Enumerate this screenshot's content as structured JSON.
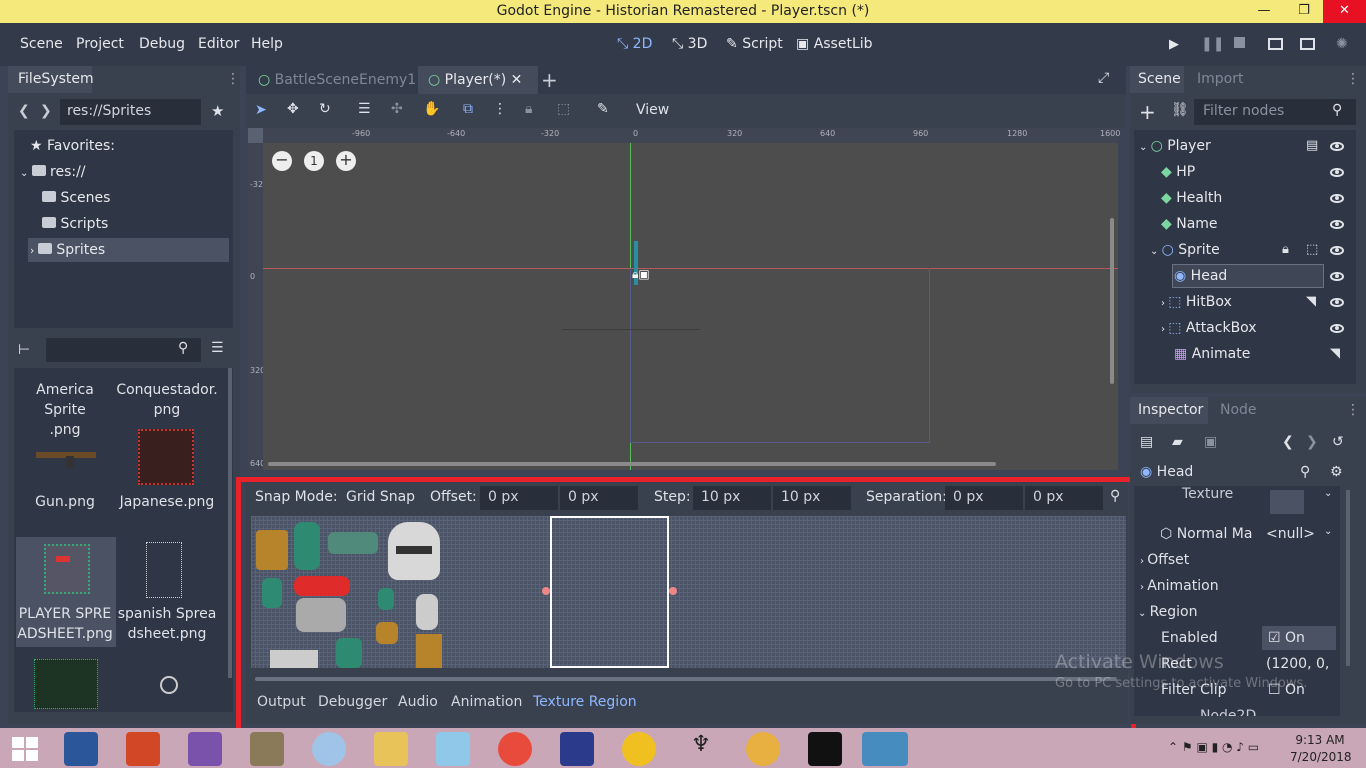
{
  "window": {
    "title": "Godot Engine - Historian Remastered - Player.tscn (*)",
    "min": "—",
    "max": "❐",
    "close": "✕"
  },
  "menu": [
    "Scene",
    "Project",
    "Debug",
    "Editor",
    "Help"
  ],
  "workspaces": [
    "2D",
    "3D",
    "Script",
    "AssetLib"
  ],
  "filesystem": {
    "tab": "FileSystem",
    "path": "res://Sprites",
    "tree": [
      "Favorites:",
      "res://",
      "Scenes",
      "Scripts",
      "Sprites"
    ],
    "files": [
      {
        "name": "America Sprite\n.png"
      },
      {
        "name": "Conquestador.\npng"
      },
      {
        "name": "Gun.png"
      },
      {
        "name": "Japanese.png"
      },
      {
        "name": "PLAYER SPRE\nADSHEET.png"
      },
      {
        "name": "spanish Sprea\ndsheet.png"
      }
    ]
  },
  "scene_tabs": [
    "BattleSceneEnemy1",
    "Player(*)"
  ],
  "toolbar": {
    "view": "View"
  },
  "ruler_x": [
    "-960",
    "-640",
    "-320",
    "0",
    "320",
    "640",
    "960",
    "1280",
    "1600"
  ],
  "ruler_y": [
    "-320",
    "0",
    "320",
    "640"
  ],
  "zoom": {
    "reset": "1"
  },
  "texture_region": {
    "snap_mode_label": "Snap Mode:",
    "snap_mode": "Grid Snap",
    "offset_label": "Offset:",
    "offset_x": "0 px",
    "offset_y": "0 px",
    "step_label": "Step:",
    "step_x": "10 px",
    "step_y": "10 px",
    "separation_label": "Separation:",
    "sep_x": "0 px",
    "sep_y": "0 px"
  },
  "bottom_tabs": [
    "Output",
    "Debugger",
    "Audio",
    "Animation",
    "Texture Region"
  ],
  "scene_dock": {
    "tabs": [
      "Scene",
      "Import"
    ],
    "filter_placeholder": "Filter nodes",
    "nodes": [
      "Player",
      "HP",
      "Health",
      "Name",
      "Sprite",
      "Head",
      "HitBox",
      "AttackBox",
      "Animate"
    ]
  },
  "inspector": {
    "tabs": [
      "Inspector",
      "Node"
    ],
    "object": "Head",
    "rows": {
      "texture": "Texture",
      "normal_map": "Normal Ma",
      "normal_value": "<null>",
      "offset": "Offset",
      "animation": "Animation",
      "region": "Region",
      "enabled": "Enabled",
      "enabled_value": "On",
      "rect": "Rect",
      "rect_value": "(1200, 0,",
      "filter_clip": "Filter Clip",
      "filter_clip_value": "On",
      "node2d": "Node2D"
    }
  },
  "watermark": {
    "line1": "Activate Windows",
    "line2": "Go to PC settings to activate Windows."
  },
  "taskbar": {
    "time": "9:13 AM",
    "date": "7/20/2018"
  },
  "colors": {
    "accent": "#8fb7ff",
    "highlight": "#e8212a",
    "titlebar": "#f4e97a"
  }
}
